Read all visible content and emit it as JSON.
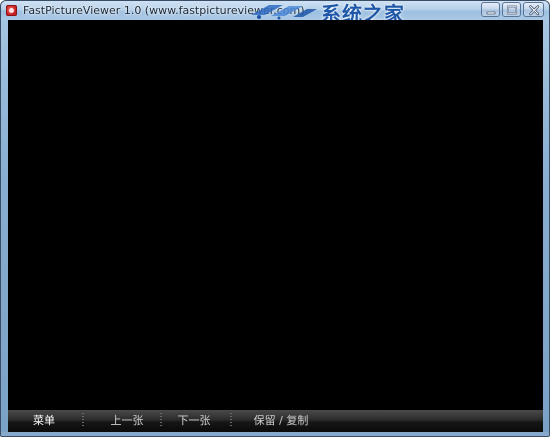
{
  "window": {
    "title": "FastPictureViewer 1.0 (www.fastpictureviewer.com)"
  },
  "watermark": {
    "text": "系统之家"
  },
  "controls": {
    "minimize_icon": "minimize-icon",
    "maximize_icon": "maximize-icon",
    "close_icon": "close-icon"
  },
  "toolbar": {
    "menu": "菜单",
    "prev": "上一张",
    "next": "下一张",
    "keep_copy": "保留 / 复制"
  },
  "colors": {
    "viewport_bg": "#000000",
    "frame": "#89aed0",
    "toolbar_text": "#cfcfcf",
    "watermark": "#1f57a8"
  }
}
